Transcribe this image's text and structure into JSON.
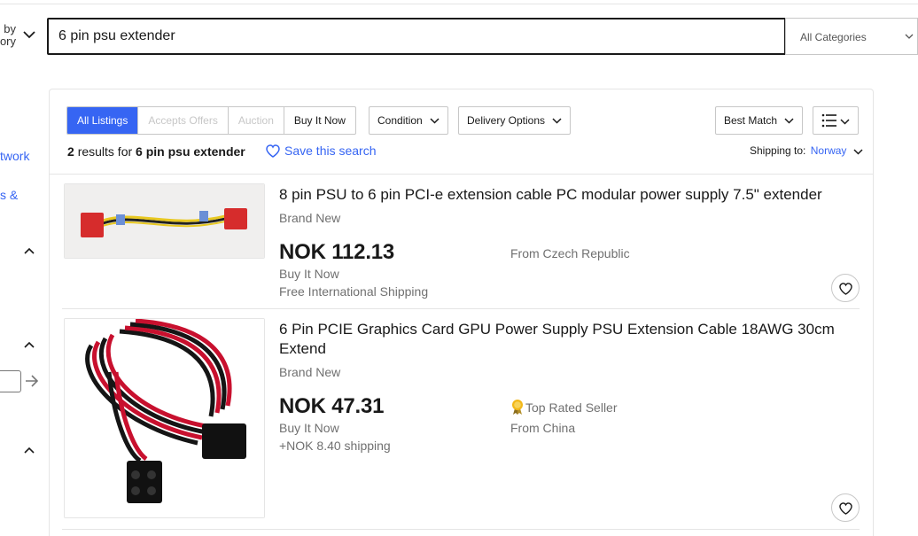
{
  "header": {
    "shop_by_category": [
      "by",
      "ory"
    ],
    "search_value": "6 pin psu extender",
    "category_select": "All Categories"
  },
  "sidebar": {
    "link_1": "twork",
    "link_2": "s &"
  },
  "tabs": [
    {
      "label": "All Listings",
      "state": "active"
    },
    {
      "label": "Accepts Offers",
      "state": "disabled"
    },
    {
      "label": "Auction",
      "state": "disabled"
    },
    {
      "label": "Buy It Now",
      "state": "normal"
    }
  ],
  "filters": {
    "condition": "Condition",
    "delivery": "Delivery Options",
    "sort": "Best Match"
  },
  "results": {
    "count": "2",
    "results_for": "results for",
    "query": "6 pin psu extender",
    "save_search": "Save this search",
    "shipping_to_label": "Shipping to:",
    "shipping_country": "Norway"
  },
  "items": [
    {
      "title": "8 pin PSU to 6 pin PCI-e extension cable PC modular power supply 7.5\" extender",
      "condition": "Brand New",
      "price": "NOK 112.13",
      "format": "Buy It Now",
      "shipping": "Free International Shipping",
      "location": "From Czech Republic"
    },
    {
      "title": "6 Pin PCIE Graphics Card GPU Power Supply PSU Extension Cable 18AWG 30cm Extend",
      "condition": "Brand New",
      "price": "NOK 47.31",
      "format": "Buy It Now",
      "shipping": "+NOK 8.40 shipping",
      "badge": "Top Rated Seller",
      "location": "From China"
    }
  ],
  "colors": {
    "accent": "#3665f3",
    "text": "#191919",
    "muted": "#707070",
    "border": "#c7c7c7"
  },
  "icons": [
    "chevron-down-icon",
    "list-view-icon",
    "heart-icon",
    "arrow-right-icon",
    "chevron-up-icon",
    "top-rated-seller-icon"
  ]
}
